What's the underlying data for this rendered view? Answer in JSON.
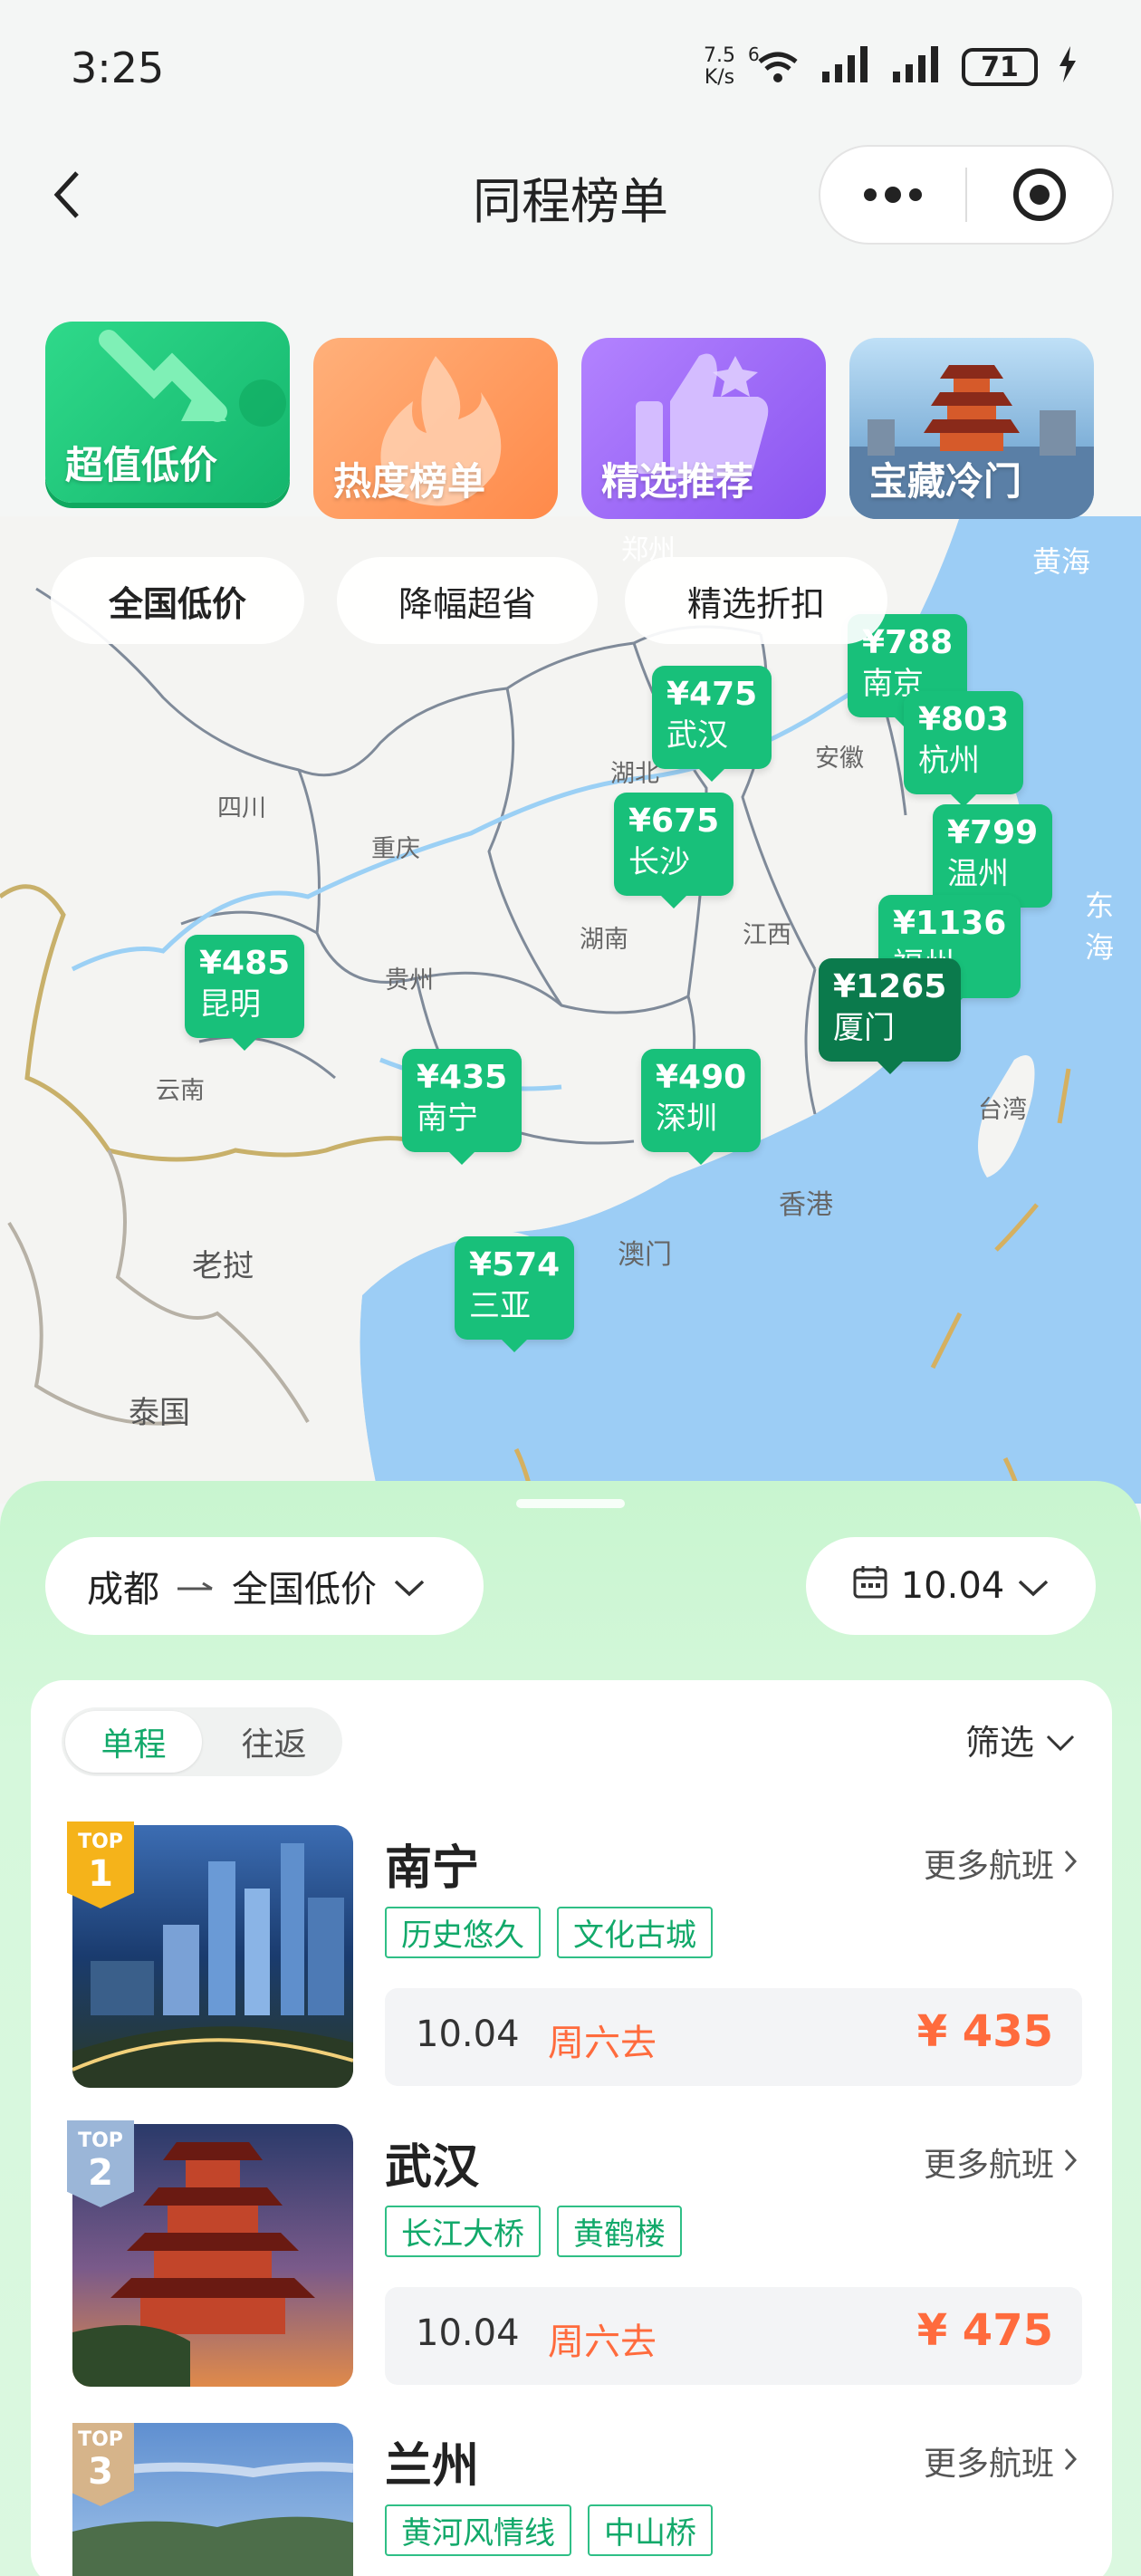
{
  "status": {
    "time": "3:25",
    "speed_top": "7.5",
    "speed_bottom": "K/s",
    "sim_badge": "6",
    "battery": "71"
  },
  "header": {
    "title": "同程榜单"
  },
  "categories": [
    {
      "label": "超值低价"
    },
    {
      "label": "热度榜单"
    },
    {
      "label": "精选推荐"
    },
    {
      "label": "宝藏冷门"
    }
  ],
  "map_tabs": [
    {
      "label": "全国低价"
    },
    {
      "label": "降幅超省"
    },
    {
      "label": "精选折扣"
    }
  ],
  "map": {
    "provinces": [
      "四川",
      "重庆",
      "贵州",
      "云南",
      "湖北",
      "湖南",
      "江西",
      "安徽",
      "台湾",
      "香港",
      "澳门",
      "黄海",
      "东海",
      "郑州"
    ],
    "regions": [
      "老挝",
      "泰国"
    ],
    "pins": [
      {
        "price": "¥788",
        "city": "南京"
      },
      {
        "price": "¥475",
        "city": "武汉"
      },
      {
        "price": "¥803",
        "city": "杭州"
      },
      {
        "price": "¥675",
        "city": "长沙"
      },
      {
        "price": "¥799",
        "city": "温州"
      },
      {
        "price": "¥1136",
        "city": "福州"
      },
      {
        "price": "¥1265",
        "city": "厦门"
      },
      {
        "price": "¥485",
        "city": "昆明"
      },
      {
        "price": "¥435",
        "city": "南宁"
      },
      {
        "price": "¥490",
        "city": "深圳"
      },
      {
        "price": "¥574",
        "city": "三亚"
      }
    ]
  },
  "sheet": {
    "origin": "成都",
    "destination": "全国低价",
    "date": "10.04",
    "trip_tabs": {
      "oneway": "单程",
      "roundtrip": "往返"
    },
    "filter": "筛选",
    "rank_top": "TOP",
    "more_label": "更多航班",
    "items": [
      {
        "rank": "1",
        "city": "南宁",
        "tags": [
          "历史悠久",
          "文化古城"
        ],
        "date": "10.04",
        "weekday": "周六去",
        "price": "¥ 435"
      },
      {
        "rank": "2",
        "city": "武汉",
        "tags": [
          "长江大桥",
          "黄鹤楼"
        ],
        "date": "10.04",
        "weekday": "周六去",
        "price": "¥ 475"
      },
      {
        "rank": "3",
        "city": "兰州",
        "tags": [
          "黄河风情线",
          "中山桥"
        ]
      }
    ]
  },
  "colors": {
    "accent": "#18c07a",
    "price": "#ff6b3d",
    "sheet": "#c8f5cf"
  }
}
